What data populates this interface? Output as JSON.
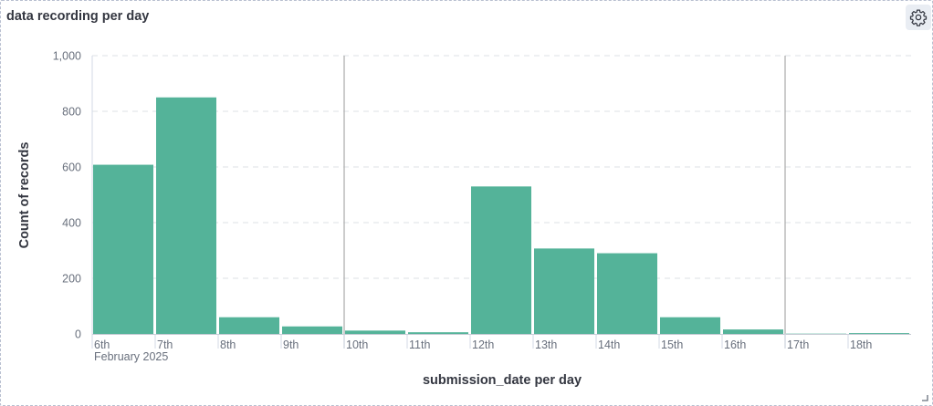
{
  "panel": {
    "title": "data recording per day",
    "settings_icon": "gear-icon",
    "resize_icon": "resize-corner-icon"
  },
  "colors": {
    "bar": "#54b399",
    "grid": "#e4e6ea",
    "week_marker": "#aaaaaa"
  },
  "chart_data": {
    "type": "bar",
    "categories": [
      "6th",
      "7th",
      "8th",
      "9th",
      "10th",
      "11th",
      "12th",
      "13th",
      "14th",
      "15th",
      "16th",
      "17th",
      "18th"
    ],
    "series": [
      {
        "values": [
          608,
          850,
          60,
          27,
          12,
          6,
          530,
          307,
          290,
          60,
          16,
          1,
          3
        ]
      }
    ],
    "x_sublabel": "February 2025",
    "xlabel": "submission_date per day",
    "ylabel": "Count of records",
    "ylim": [
      0,
      1000
    ],
    "yticks": [
      0,
      200,
      400,
      600,
      800,
      1000
    ],
    "ytick_labels": [
      "0",
      "200",
      "400",
      "600",
      "800",
      "1,000"
    ],
    "week_markers_before": [
      "10th",
      "17th"
    ],
    "grid": true,
    "grid_style": "dashed-horizontal",
    "legend": false
  }
}
